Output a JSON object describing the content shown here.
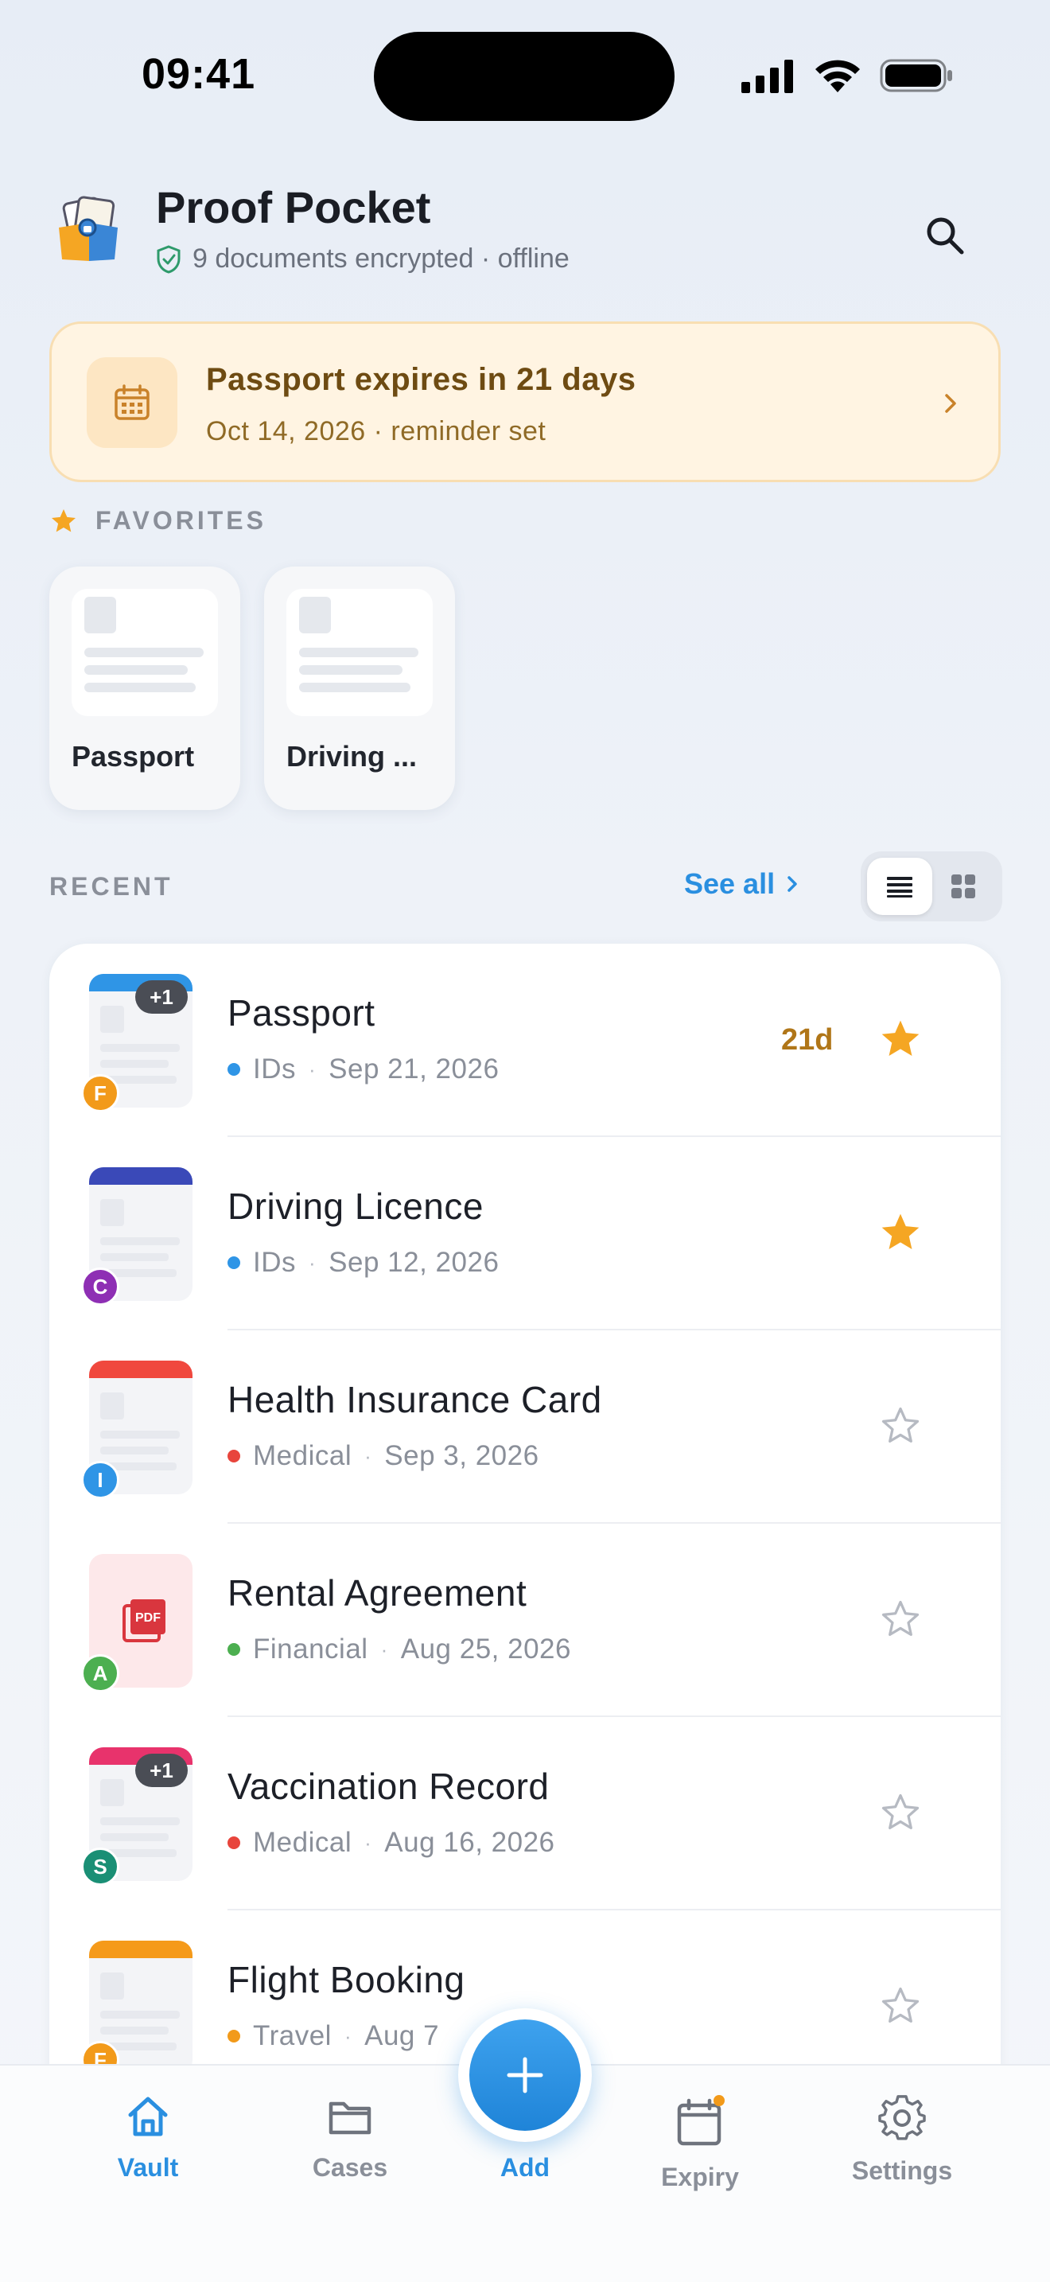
{
  "status_bar": {
    "time": "09:41"
  },
  "header": {
    "title": "Proof Pocket",
    "subtitle": "9 documents encrypted · offline"
  },
  "alert": {
    "title": "Passport expires in 21 days",
    "subtitle": "Oct 14, 2026 · reminder set"
  },
  "favorites": {
    "heading": "FAVORITES",
    "items": [
      {
        "label": "Passport"
      },
      {
        "label": "Driving ..."
      }
    ]
  },
  "recent": {
    "heading": "RECENT",
    "see_all": "See all",
    "items": [
      {
        "title": "Passport",
        "category": "IDs",
        "category_color": "#2f95e6",
        "date": "Sep 21, 2026",
        "avatar": "F",
        "avatar_color": "#f29a1a",
        "thumb_color": "#2f95e6",
        "extra_pages": "+1",
        "days_left": "21d",
        "favorite": true
      },
      {
        "title": "Driving Licence",
        "category": "IDs",
        "category_color": "#2f95e6",
        "date": "Sep 12, 2026",
        "avatar": "C",
        "avatar_color": "#8e2fb4",
        "thumb_color": "#3a49b8",
        "favorite": true
      },
      {
        "title": "Health Insurance Card",
        "category": "Medical",
        "category_color": "#e8453c",
        "date": "Sep 3, 2026",
        "avatar": "I",
        "avatar_color": "#2f95e6",
        "thumb_color": "#f0483e",
        "favorite": false
      },
      {
        "title": "Rental Agreement",
        "category": "Financial",
        "category_color": "#4caf50",
        "date": "Aug 25, 2026",
        "avatar": "A",
        "avatar_color": "#4caf50",
        "thumb_type": "PDF",
        "favorite": false
      },
      {
        "title": "Vaccination Record",
        "category": "Medical",
        "category_color": "#e8453c",
        "date": "Aug 16, 2026",
        "avatar": "S",
        "avatar_color": "#1a8f75",
        "thumb_color": "#e8336c",
        "extra_pages": "+1",
        "favorite": false
      },
      {
        "title": "Flight Booking",
        "category": "Travel",
        "category_color": "#f29a1a",
        "date": "Aug 7",
        "avatar": "F",
        "avatar_color": "#f29a1a",
        "thumb_color": "#f59a1a",
        "favorite": false
      }
    ]
  },
  "tabs": [
    {
      "label": "Vault",
      "icon": "home-icon",
      "active": true
    },
    {
      "label": "Cases",
      "icon": "folder-icon",
      "active": false
    },
    {
      "label": "Add",
      "icon": "plus-icon",
      "active": false
    },
    {
      "label": "Expiry",
      "icon": "calendar-icon",
      "active": false
    },
    {
      "label": "Settings",
      "icon": "gear-icon",
      "active": false
    }
  ],
  "colors": {
    "accent": "#2a8fe0",
    "star": "#f5a623",
    "alert_bg": "#fff4e2",
    "alert_text": "#6e4b12"
  }
}
